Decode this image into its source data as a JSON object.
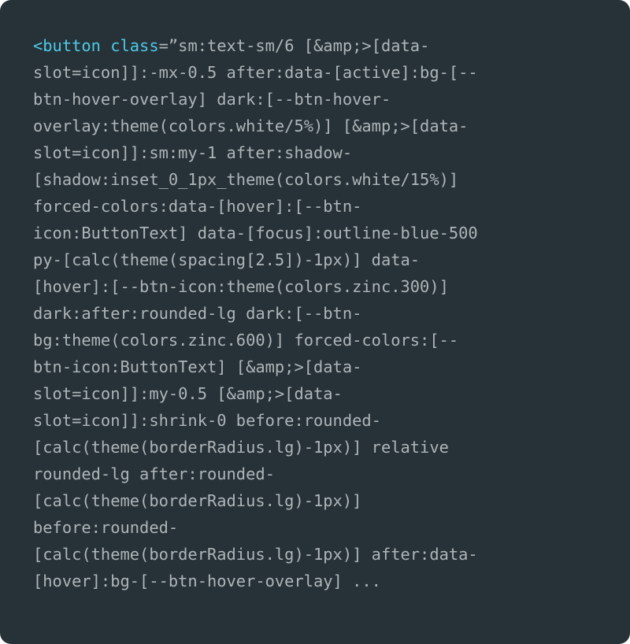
{
  "code": {
    "tag": "<button",
    "attr_name": "class",
    "equals": "=",
    "first_line_rest": "”sm:text-sm/6 [&amp;>[data-",
    "lines": [
      "slot=icon]]:-mx-0.5 after:data-[active]:bg-[--",
      "btn-hover-overlay] dark:[--btn-hover-",
      "overlay:theme(colors.white/5%)] [&amp;>[data-",
      "slot=icon]]:sm:my-1 after:shadow-",
      "[shadow:inset_0_1px_theme(colors.white/15%)]",
      "forced-colors:data-[hover]:[--btn-",
      "icon:ButtonText] data-[focus]:outline-blue-500",
      "py-[calc(theme(spacing[2.5])-1px)] data-",
      "[hover]:[--btn-icon:theme(colors.zinc.300)]",
      "dark:after:rounded-lg dark:[--btn-",
      "bg:theme(colors.zinc.600)] forced-colors:[--",
      "btn-icon:ButtonText] [&amp;>[data-",
      "slot=icon]]:my-0.5 [&amp;>[data-",
      "slot=icon]]:shrink-0 before:rounded-",
      "[calc(theme(borderRadius.lg)-1px)] relative",
      "rounded-lg after:rounded-",
      "[calc(theme(borderRadius.lg)-1px)]",
      "before:rounded-",
      "[calc(theme(borderRadius.lg)-1px)] after:data-",
      "[hover]:bg-[--btn-hover-overlay] ..."
    ]
  },
  "colors": {
    "background": "#263238",
    "text": "#aeb5b8",
    "keyword": "#4ec9e6"
  }
}
